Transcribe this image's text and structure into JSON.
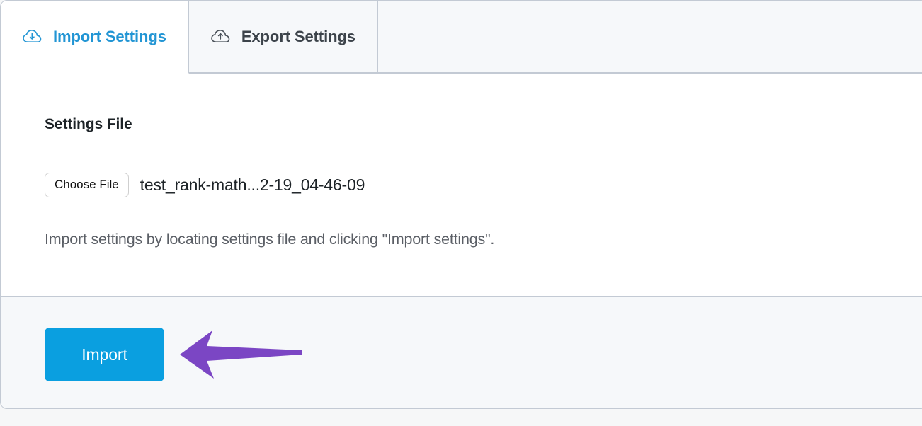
{
  "tabs": [
    {
      "label": "Import Settings",
      "icon": "cloud-download-icon",
      "active": true
    },
    {
      "label": "Export Settings",
      "icon": "cloud-upload-icon",
      "active": false
    }
  ],
  "main": {
    "section_title": "Settings File",
    "choose_file_label": "Choose File",
    "file_name": "test_rank-math...2-19_04-46-09",
    "hint": "Import settings by locating settings file and clicking \"Import settings\"."
  },
  "footer": {
    "import_label": "Import"
  },
  "annotation": {
    "type": "arrow",
    "direction": "left",
    "points_to": "import-button",
    "color": "#7b46c4"
  },
  "colors": {
    "accent_blue": "#0a9fe0",
    "active_tab_text": "#2295d4",
    "inactive_tab_text": "#3c434a",
    "border": "#c3cad4",
    "panel_bg": "#ffffff",
    "strip_bg": "#f6f8fa",
    "annotation_purple": "#7b46c4"
  }
}
